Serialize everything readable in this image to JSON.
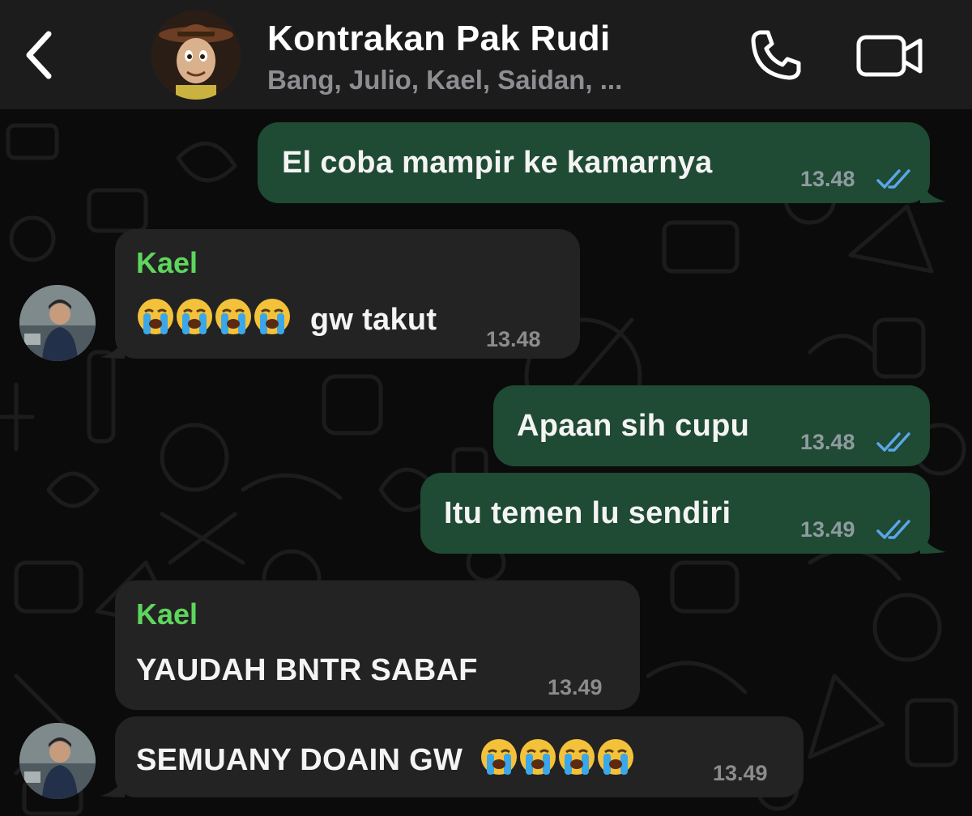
{
  "header": {
    "title": "Kontrakan Pak Rudi",
    "subtitle": "Bang, Julio, Kael, Saidan, ..."
  },
  "icons": {
    "back": "chevron-left-icon",
    "call": "phone-icon",
    "video": "video-camera-icon"
  },
  "colors": {
    "outgoing_bubble": "#1f4a33",
    "incoming_bubble": "#232323",
    "sender_name": "#5ed55c",
    "read_ticks": "#5aa6e8"
  },
  "messages": [
    {
      "direction": "out",
      "text": "El coba mampir ke kamarnya",
      "time": "13.48",
      "status": "read"
    },
    {
      "direction": "in",
      "sender": "Kael",
      "emoji": "loudly-crying-face x4",
      "text": "gw takut",
      "time": "13.48"
    },
    {
      "direction": "out",
      "text": "Apaan sih cupu",
      "time": "13.48",
      "status": "read"
    },
    {
      "direction": "out",
      "text": "Itu temen lu sendiri",
      "time": "13.49",
      "status": "read"
    },
    {
      "direction": "in",
      "sender": "Kael",
      "text": "YAUDAH BNTR SABAF",
      "time": "13.49"
    },
    {
      "direction": "in",
      "text": "SEMUANY DOAIN GW",
      "emoji": "loudly-crying-face x4",
      "time": "13.49"
    }
  ]
}
